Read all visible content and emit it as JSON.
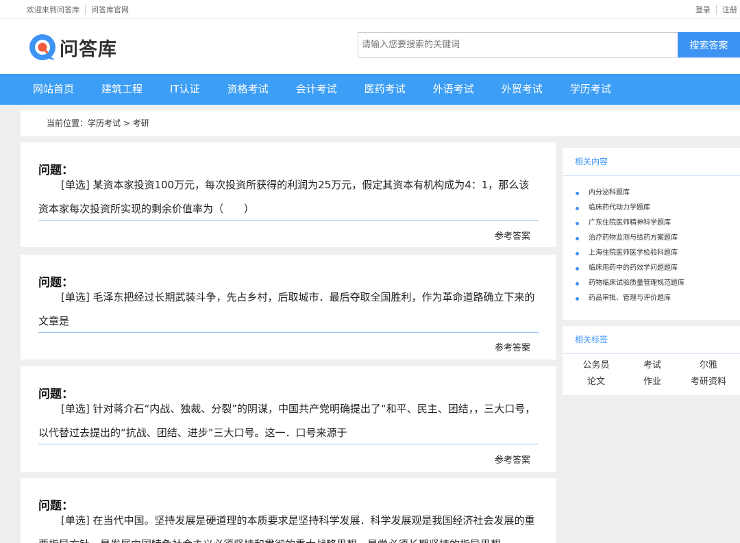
{
  "topbar": {
    "welcome": "欢迎来到问答库",
    "official": "问答库官网",
    "login": "登录",
    "register": "注册"
  },
  "header": {
    "logo_text": "问答库",
    "search_placeholder": "请输入您要搜索的关键词",
    "search_button": "搜索答案"
  },
  "nav": [
    "网站首页",
    "建筑工程",
    "IT认证",
    "资格考试",
    "会计考试",
    "医药考试",
    "外语考试",
    "外贸考试",
    "学历考试"
  ],
  "breadcrumb": "当前位置：学历考试 > 考研",
  "questions": [
    {
      "title": "问题：",
      "text": "[单选] 某资本家投资100万元，每次投资所获得的利润为25万元，假定其资本有机构成为4：1，那么该资本家每次投资所实现的剩余价值率为（　　）",
      "answer": "参考答案"
    },
    {
      "title": "问题：",
      "text": "[单选] 毛泽东把经过长期武装斗争，先占乡村，后取城市．最后夺取全国胜利，作为革命道路确立下来的文章是",
      "answer": "参考答案"
    },
    {
      "title": "问题：",
      "text": "[单选] 针对蒋介石“内战、独裁、分裂”的阴谋，中国共产党明确提出了“和平、民主、团结，，三大口号，以代替过去提出的“抗战、团结、进步”三大口号。这一．口号来源于",
      "answer": "参考答案"
    },
    {
      "title": "问题：",
      "text": "[单选] 在当代中国。坚持发展是硬道理的本质要求是坚持科学发展．科学发展观是我国经济社会发展的重要指导方针，是发展中国特色社会主义必须坚持和贯彻的重大战略思想，是党必须长期坚持的指导思想"
    }
  ],
  "related_content": {
    "title": "相关内容",
    "items": [
      "内分泌科题库",
      "临床药代动力学题库",
      "广东住院医师精神科学题库",
      "治疗药物监测与给药方案题库",
      "上海住院医师医学检验科题库",
      "临床用药中的药效学问题题库",
      "药物临床试验质量管理规范题库",
      "药品审批、管理与评价题库"
    ]
  },
  "related_tags": {
    "title": "相关标签",
    "items": [
      "公务员",
      "考试",
      "尔雅",
      "论文",
      "作业",
      "考研资料"
    ]
  },
  "colors": {
    "brand_blue": "#3c93f4",
    "nav_blue": "#3c9ef4",
    "logo_red": "#f05a3c"
  }
}
